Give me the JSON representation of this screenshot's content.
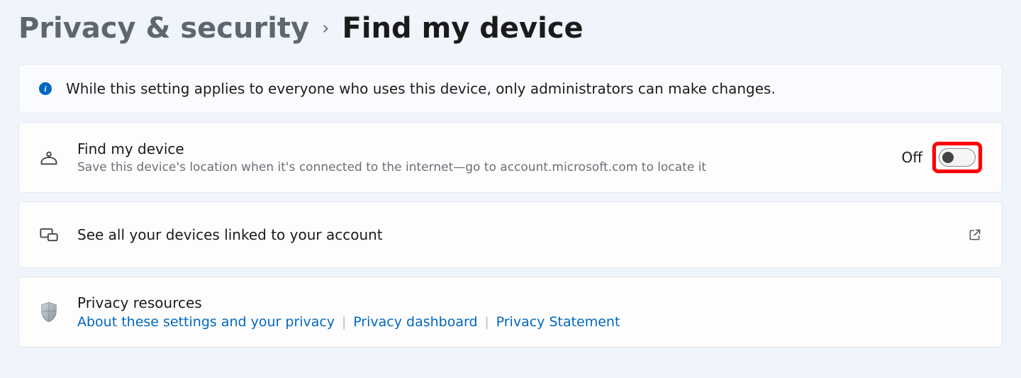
{
  "breadcrumb": {
    "parent": "Privacy & security",
    "current": "Find my device"
  },
  "info_banner": {
    "text": "While this setting applies to everyone who uses this device, only administrators can make changes."
  },
  "find_my_device": {
    "title": "Find my device",
    "description": "Save this device's location when it's connected to the internet—go to account.microsoft.com to locate it",
    "toggle_state_label": "Off",
    "toggle_on": false
  },
  "devices_link": {
    "label": "See all your devices linked to your account"
  },
  "privacy_resources": {
    "title": "Privacy resources",
    "links": [
      "About these settings and your privacy",
      "Privacy dashboard",
      "Privacy Statement"
    ]
  }
}
